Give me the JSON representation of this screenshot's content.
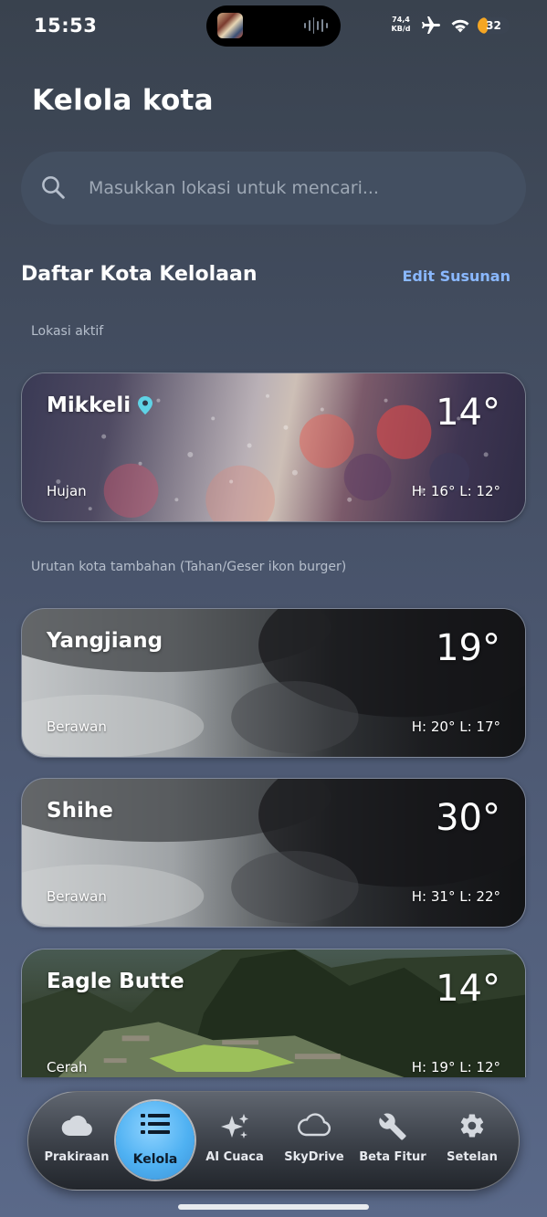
{
  "status_bar": {
    "time": "15:53",
    "net_speed_value": "74,4",
    "net_speed_unit": "KB/d",
    "battery_percent": 32,
    "battery_label": "32",
    "battery_color": "#f5a623",
    "icons": [
      "airplane-icon",
      "wifi-icon"
    ]
  },
  "header": {
    "title": "Kelola kota"
  },
  "search": {
    "placeholder": "Masukkan lokasi untuk mencari...",
    "value": ""
  },
  "list": {
    "title": "Daftar Kota Kelolaan",
    "edit_label": "Edit Susunan",
    "edit_color": "#8ab8ff",
    "active_hint": "Lokasi aktif",
    "extra_hint": "Urutan kota tambahan (Tahan/Geser ikon burger)"
  },
  "cities": [
    {
      "name": "Mikkeli",
      "temp": "14°",
      "condition": "Hujan",
      "hl": "H: 16°  L: 12°",
      "location_icon": "map-pin-icon",
      "pin_color": "#5fd3e6",
      "background": "rain-window"
    },
    {
      "name": "Yangjiang",
      "temp": "19°",
      "condition": "Berawan",
      "hl": "H: 20°  L: 17°",
      "background": "storm-clouds"
    },
    {
      "name": "Shihe",
      "temp": "30°",
      "condition": "Berawan",
      "hl": "H: 31°  L: 22°",
      "background": "storm-clouds"
    },
    {
      "name": "Eagle Butte",
      "temp": "14°",
      "condition": "Cerah",
      "hl": "H: 19°  L: 12°",
      "background": "mountain-ruins"
    }
  ],
  "nav": {
    "items": [
      {
        "label": "Prakiraan",
        "icon": "cloud-icon"
      },
      {
        "label": "Kelola",
        "icon": "list-icon",
        "active": true
      },
      {
        "label": "AI Cuaca",
        "icon": "sparkles-icon"
      },
      {
        "label": "SkyDrive",
        "icon": "cloud-outline-icon"
      },
      {
        "label": "Beta Fitur",
        "icon": "wrench-icon"
      },
      {
        "label": "Setelan",
        "icon": "gear-icon"
      }
    ],
    "active_color": "#4fb1f2"
  }
}
